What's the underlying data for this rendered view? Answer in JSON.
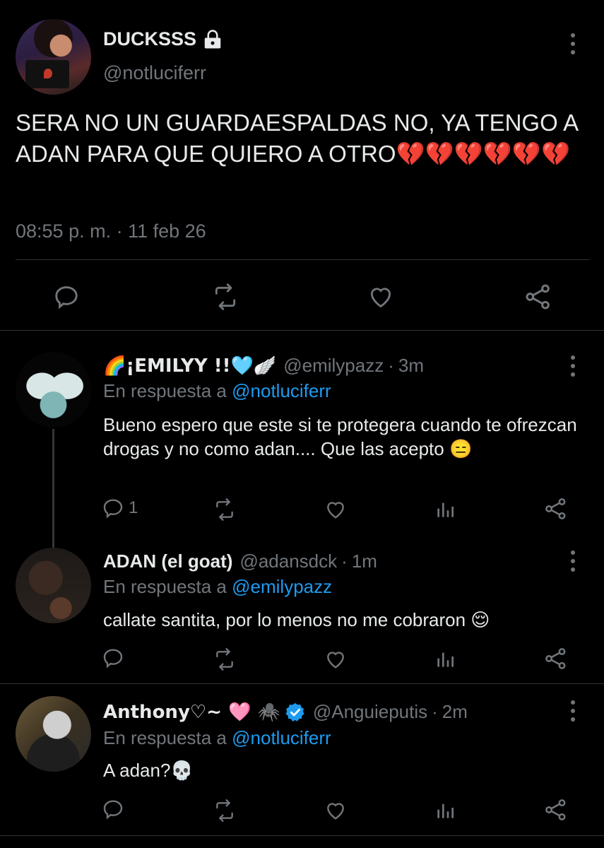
{
  "main_tweet": {
    "display_name": "DUCKSSS",
    "handle": "@notluciferr",
    "text": "SERA NO UN GUARDAESPALDAS NO, YA TENGO A ADAN PARA QUE QUIERO A OTRO💔💔💔💔💔💔",
    "timestamp": "08:55 p. m. · 11 feb 26",
    "actions": [
      "reply-icon",
      "retweet-icon",
      "like-icon",
      "share-icon"
    ]
  },
  "replies": [
    {
      "display_name": "🌈¡EMILYY !!🩵🪽",
      "handle": "@emilypazz",
      "time": "3m",
      "in_reply_prefix": "En respuesta a",
      "in_reply_to": "@notluciferr",
      "text": "Bueno espero que este si te protegera cuando te ofrezcan drogas y no como adan.... Que las acepto 😑",
      "reply_count": "1"
    },
    {
      "display_name": "ADAN (el goat)",
      "handle": "@adansdck",
      "time": "1m",
      "in_reply_prefix": "En respuesta a",
      "in_reply_to": "@emilypazz",
      "text": "callate santita, por lo menos no me cobraron 😌",
      "reply_count": ""
    },
    {
      "display_name": "Anthony♡~ 🩷 🕷️",
      "handle": "@Anguieputis",
      "time": "2m",
      "in_reply_prefix": "En respuesta a",
      "in_reply_to": "@notluciferr",
      "text": "A adan?💀",
      "reply_count": ""
    }
  ],
  "colors": {
    "background": "#000000",
    "text": "#e7e9ea",
    "secondary": "#71767b",
    "link": "#1d9bf0",
    "divider": "#2f3336"
  }
}
